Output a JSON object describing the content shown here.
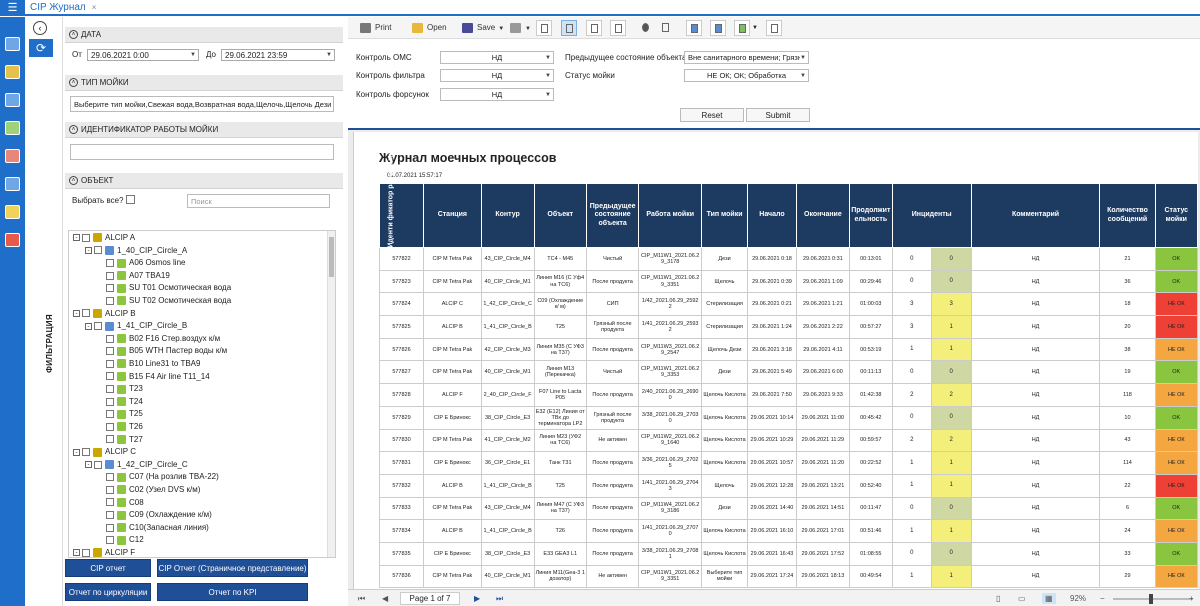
{
  "app": {
    "tab_title": "CIP Журнал",
    "close": "×"
  },
  "filter_label": "ФИЛЬТРАЦИЯ",
  "sections": {
    "date": "ДАТА",
    "wash_type": "ТИП МОЙКИ",
    "wash_id": "ИДЕНТИФИКАТОР РАБОТЫ МОЙКИ",
    "object": "ОБЪЕКТ"
  },
  "date": {
    "from_label": "От",
    "from_value": "29.06.2021 0:00",
    "to_label": "До",
    "to_value": "29.06.2021 23:59"
  },
  "wash_type_value": "Выберите тип мойки,Свежая вода,Возвратная вода,Щелочь,Щелочь Дези",
  "object": {
    "select_all": "Выбрать все?",
    "search_placeholder": "Поиск"
  },
  "tree": [
    {
      "l": 0,
      "t": "ALCIP A",
      "ic": "gear",
      "tg": "-"
    },
    {
      "l": 1,
      "t": "1_40_CIP_Circle_A",
      "ic": "lo",
      "tg": "-"
    },
    {
      "l": 2,
      "t": "A06 Osmos line",
      "ic": "g"
    },
    {
      "l": 2,
      "t": "A07 TBA19",
      "ic": "g"
    },
    {
      "l": 2,
      "t": "SU T01  Осмотическая вода",
      "ic": "g"
    },
    {
      "l": 2,
      "t": "SU T02  Осмотическая вода",
      "ic": "g"
    },
    {
      "l": 0,
      "t": "ALCIP B",
      "ic": "gear",
      "tg": "-"
    },
    {
      "l": 1,
      "t": "1_41_CIP_Circle_B",
      "ic": "lo",
      "tg": "-"
    },
    {
      "l": 2,
      "t": "B02 F16 Стер.воздух к/м",
      "ic": "g"
    },
    {
      "l": 2,
      "t": "B05 WTH Пастер воды к/м",
      "ic": "g"
    },
    {
      "l": 2,
      "t": "B10 Line31 to TBA9",
      "ic": "g"
    },
    {
      "l": 2,
      "t": "B15 F4 Air line T11_14",
      "ic": "g"
    },
    {
      "l": 2,
      "t": "T23",
      "ic": "g"
    },
    {
      "l": 2,
      "t": "T24",
      "ic": "g"
    },
    {
      "l": 2,
      "t": "T25",
      "ic": "g"
    },
    {
      "l": 2,
      "t": "T26",
      "ic": "g"
    },
    {
      "l": 2,
      "t": "T27",
      "ic": "g"
    },
    {
      "l": 0,
      "t": "ALCIP C",
      "ic": "gear",
      "tg": "-"
    },
    {
      "l": 1,
      "t": "1_42_CIP_Circle_C",
      "ic": "lo",
      "tg": "-"
    },
    {
      "l": 2,
      "t": "C07 (На розлив TBA-22)",
      "ic": "g"
    },
    {
      "l": 2,
      "t": "C02 (Узел DVS к/м)",
      "ic": "g"
    },
    {
      "l": 2,
      "t": "C08",
      "ic": "g"
    },
    {
      "l": 2,
      "t": "C09 (Охлаждение к/м)",
      "ic": "g"
    },
    {
      "l": 2,
      "t": "C10(Запасная линия)",
      "ic": "g"
    },
    {
      "l": 2,
      "t": "C12",
      "ic": "g"
    },
    {
      "l": 0,
      "t": "ALCIP F",
      "ic": "gear",
      "tg": "-"
    }
  ],
  "left_buttons": {
    "cip_report": "CIP отчет",
    "cip_report_paged": "CIP Отчет (Страничное представление)",
    "circ_report": "Отчет по циркуляции",
    "kpi_report": "Отчет по KPI"
  },
  "toolbar": {
    "print": "Print",
    "open": "Open",
    "save": "Save"
  },
  "params": {
    "omc_label": "Контроль ОМС",
    "omc_value": "НД",
    "filter_label": "Контроль фильтра",
    "filter_value": "НД",
    "nozzle_label": "Контроль форсунок",
    "nozzle_value": "НД",
    "prev_state_label": "Предыдущее состояние объекта",
    "prev_state_value": "Вне санитарного времени; Грязн",
    "status_label": "Статус мойки",
    "status_value": "НЕ ОК; ОК; Обработка",
    "reset": "Reset",
    "submit": "Submit"
  },
  "report": {
    "title": "Журнал моечных процессов",
    "date": "01.07.2021 15:57:17",
    "columns": [
      "Иденти фикатор работы мойки",
      "Станция",
      "Контур",
      "Объект",
      "Предыдущее состояние объекта",
      "Работа мойки",
      "Тип мойки",
      "Начало",
      "Окончание",
      "Продолжит ельность",
      "Инциденты",
      "Комментарий",
      "Количество сообщений",
      "Статус мойки"
    ],
    "rows": [
      [
        "577822",
        "CIP M Tetra Pak",
        "43_CIP_Circle_M4",
        "TC4 - M45",
        "Чистый",
        "CIP_M11W1_2021.06.2 9_3178",
        "Дези",
        "29.06.2021 0:18",
        "29.06.2021 0:31",
        "00:13:01",
        "0",
        "0",
        "НД",
        "21",
        "OK"
      ],
      [
        "577823",
        "CIP M Tetra Pak",
        "40_CIP_Circle_M1",
        "Линия M16 (С Уф4 на TC6)",
        "После продукта",
        "CIP_M11W1_2021.06.2 9_3351",
        "Щелочь",
        "29.06.2021 0:39",
        "29.06.2021 1:09",
        "00:29:46",
        "0",
        "0",
        "НД",
        "36",
        "OK"
      ],
      [
        "577824",
        "ALCIP C",
        "1_42_CIP_Circle_C",
        "C09 (Охлаждение к/ м)",
        "СИП",
        "1/42_2021.06.29_2592 2",
        "Стерилизация",
        "29.06.2021 0:21",
        "29.06.2021 1:21",
        "01:00:03",
        "3",
        "3",
        "НД",
        "18",
        "НЕ ОК"
      ],
      [
        "577825",
        "ALCIP B",
        "1_41_CIP_Circle_B",
        "T25",
        "Грязный после продукта",
        "1/41_2021.06.29_2593 2",
        "Стерилизация",
        "29.06.2021 1:24",
        "29.06.2021 2:22",
        "00:57:27",
        "3",
        "1",
        "НД",
        "20",
        "НЕ ОК"
      ],
      [
        "577826",
        "CIP M Tetra Pak",
        "42_CIP_Circle_M3",
        "Линия M35 (С УФ3 на T37)",
        "После продукта",
        "CIP_M11W3_2021.06.2 9_2547",
        "Щелочь Дези",
        "29.06.2021 3:18",
        "29.06.2021 4:11",
        "00:53:19",
        "1",
        "1",
        "НД",
        "38",
        "НЕ ОК"
      ],
      [
        "577827",
        "CIP M Tetra Pak",
        "40_CIP_Circle_M1",
        "Линия M13 (Перекачка)",
        "Чистый",
        "CIP_M11W1_2021.06.2 9_3353",
        "Дези",
        "29.06.2021 5:49",
        "29.06.2021 6:00",
        "00:11:13",
        "0",
        "0",
        "НД",
        "19",
        "OK"
      ],
      [
        "577828",
        "ALCIP F",
        "2_40_CIP_Circle_F",
        "F07 Line to Lacta P05",
        "После продукта",
        "2/40_2021.06.29_2690 0",
        "Щелочь Кислота",
        "29.06.2021 7:50",
        "29.06.2021 9:33",
        "01:42:38",
        "2",
        "2",
        "НД",
        "118",
        "НЕ ОК"
      ],
      [
        "577829",
        "CIP E Бринокс",
        "38_CIP_Circle_E3",
        "E32 (E12) Линия от ТВх до терминатора LP2",
        "Грязный после продукта",
        "3/38_2021.06.29_2703 0",
        "Щелочь Кислота",
        "29.06.2021 10:14",
        "29.06.2021 11:00",
        "00:45:42",
        "0",
        "0",
        "НД",
        "10",
        "OK"
      ],
      [
        "577830",
        "CIP M Tetra Pak",
        "41_CIP_Circle_M2",
        "Линия M23 (УФ2 на TC6)",
        "Не активен",
        "CIP_M11W2_2021.06.2 9_1640",
        "Щелочь Кислота",
        "29.06.2021 10:29",
        "29.06.2021 11:29",
        "00:59:57",
        "2",
        "2",
        "НД",
        "43",
        "НЕ ОК"
      ],
      [
        "577831",
        "CIP E Бринокс",
        "36_CIP_Circle_E1",
        "Танк T31",
        "После продукта",
        "3/36_2021.06.29_2702 5",
        "Щелочь Кислота",
        "29.06.2021 10:57",
        "29.06.2021 11:20",
        "00:22:52",
        "1",
        "1",
        "НД",
        "114",
        "НЕ ОК"
      ],
      [
        "577832",
        "ALCIP B",
        "1_41_CIP_Circle_B",
        "T25",
        "После продукта",
        "1/41_2021.06.29_2704 3",
        "Щелочь",
        "29.06.2021 12:28",
        "29.06.2021 13:21",
        "00:52:40",
        "1",
        "1",
        "НД",
        "22",
        "НЕ ОК"
      ],
      [
        "577833",
        "CIP M Tetra Pak",
        "43_CIP_Circle_M4",
        "Линия M47 (С УФ3 на T37)",
        "После продукта",
        "CIP_M11W4_2021.06.2 9_3186",
        "Дези",
        "29.06.2021 14:40",
        "29.06.2021 14:51",
        "00:11:47",
        "0",
        "0",
        "НД",
        "6",
        "OK"
      ],
      [
        "577834",
        "ALCIP B",
        "1_41_CIP_Circle_B",
        "T26",
        "После продукта",
        "1/41_2021.06.29_2707 0",
        "Щелочь Кислота",
        "29.06.2021 16:10",
        "29.06.2021 17:01",
        "00:51:46",
        "1",
        "1",
        "НД",
        "24",
        "НЕ ОК"
      ],
      [
        "577835",
        "CIP E Бринокс",
        "38_CIP_Circle_E3",
        "E33 GEA3 L1",
        "После продукта",
        "3/38_2021.06.29_2708 1",
        "Щелочь Кислота",
        "29.06.2021 16:43",
        "29.06.2021 17:52",
        "01:08:55",
        "0",
        "0",
        "НД",
        "33",
        "OK"
      ],
      [
        "577836",
        "CIP M Tetra Pak",
        "40_CIP_Circle_M1",
        "Линия M11(Gea-3 1 дозатор)",
        "Не активен",
        "CIP_M11W1_2021.06.2 9_3351",
        "Выберите тип мойки",
        "29.06.2021 17:24",
        "29.06.2021 18:13",
        "00:49:54",
        "1",
        "1",
        "НД",
        "29",
        "НЕ ОК"
      ]
    ]
  },
  "statusbar": {
    "page": "Page 1 of 7",
    "zoom": "92%"
  },
  "colors": {
    "header": "#1d3a60",
    "ok": "#8ac53f",
    "not_ok_red": "#ee4035",
    "not_ok_orange": "#f4a640",
    "incident_yellow": "#f4ef7a",
    "incident_zero": "#cfd8a2",
    "accent": "#1f6ec9"
  }
}
